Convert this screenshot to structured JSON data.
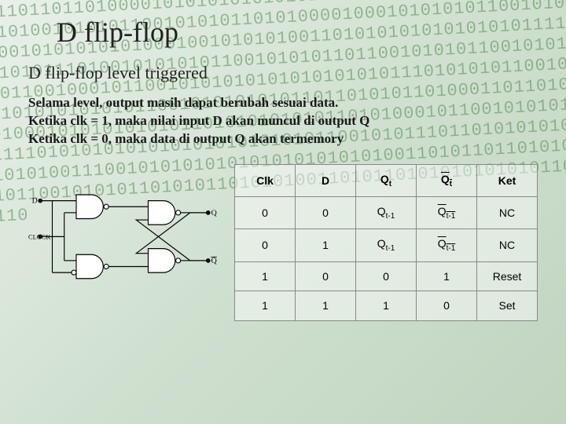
{
  "bg_bits": "1011011011010000101010101010101010101010101010001001010101011001010100101010110010101011010100001000101010101100101010010101010000101010101010001001010101001101010101010101010111101010101101010101110100101010101100101010110110010101011001010101010101010101100100010110010101010101010101010111010101011001010101001001110101010101011001010101010110110101011010001101101010101011010010001010101010101101010101010110101000101100101010110110010010111101010101010101010101010101100101011101101010101011011011010101010011100101010101010101010101010011010110110101010101101010101100101010110101011010101001101011010101010101011001010101010110",
  "title": "D flip-flop",
  "subtitle": "D flip-flop level triggered",
  "desc_line1": "Selama level, output masih dapat berubah sesuai data.",
  "desc_line2": "Ketika clk = 1, maka nilai input D akan muncul di output Q",
  "desc_line3": "Ketika clk = 0, maka data di output Q akan termemory",
  "circuit": {
    "input_d": "D",
    "input_clk": "CLOCK",
    "output_q": "Q",
    "output_qbar": "Q"
  },
  "table": {
    "headers": {
      "clk": "Clk",
      "d": "D",
      "qt": "Q",
      "qtbar": "Q",
      "ket": "Ket"
    },
    "sub_t": "t",
    "sub_t1": "t-1",
    "rows": [
      {
        "clk": "0",
        "d": "0",
        "qt": "Q",
        "qtbar": "Q",
        "ket": "NC"
      },
      {
        "clk": "0",
        "d": "1",
        "qt": "Q",
        "qtbar": "Q",
        "ket": "NC"
      },
      {
        "clk": "1",
        "d": "0",
        "qt": "0",
        "qtbar": "1",
        "ket": "Reset"
      },
      {
        "clk": "1",
        "d": "1",
        "qt": "1",
        "qtbar": "0",
        "ket": "Set"
      }
    ]
  }
}
